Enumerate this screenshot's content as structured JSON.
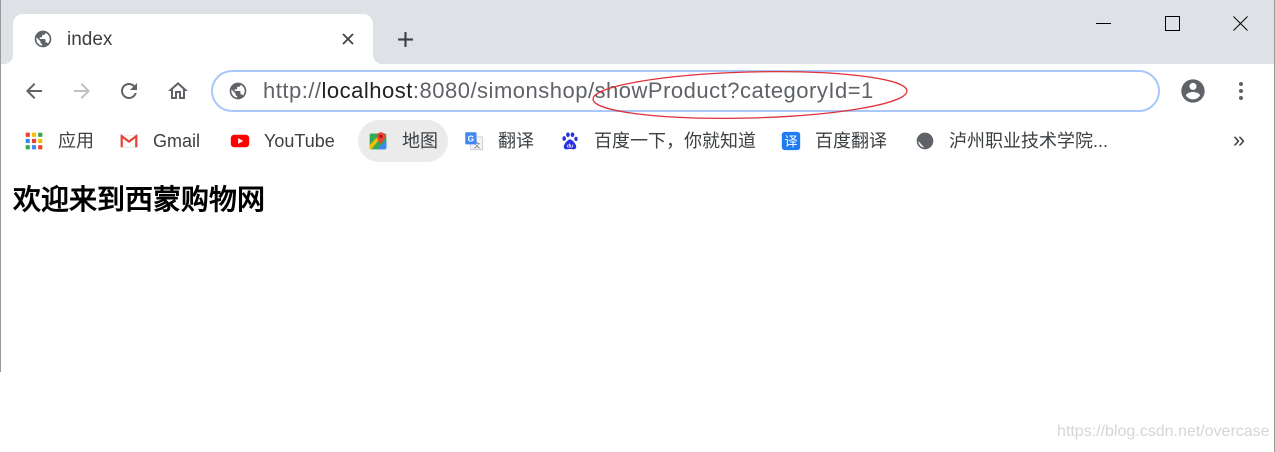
{
  "tabs": [
    {
      "title": "index",
      "favicon": "globe-icon",
      "close_icon": "close-icon",
      "active": true
    }
  ],
  "tab_strip": {
    "new_tab_icon": "plus-icon"
  },
  "window_controls": {
    "minimize_icon": "minimize-icon",
    "maximize_icon": "maximize-icon",
    "close_icon": "close-icon"
  },
  "toolbar": {
    "back_icon": "arrow-back-icon",
    "forward_icon": "arrow-forward-icon",
    "forward_enabled": false,
    "reload_icon": "reload-icon",
    "home_icon": "home-icon",
    "profile_icon": "account-circle-icon",
    "menu_icon": "more-vert-icon"
  },
  "omnibox": {
    "site_info_icon": "globe-icon",
    "focused": true,
    "url": {
      "scheme": "http://",
      "host": "localhost",
      "path": ":8080/simonshop/showProduct?categoryId=1"
    }
  },
  "bookmarks": {
    "items": [
      {
        "label": "应用",
        "icon": "apps-grid-icon"
      },
      {
        "label": "Gmail",
        "icon": "gmail-icon"
      },
      {
        "label": "YouTube",
        "icon": "youtube-icon"
      },
      {
        "label": "地图",
        "icon": "google-maps-icon",
        "hovered": true
      },
      {
        "label": "翻译",
        "icon": "google-translate-icon",
        "logo_text": [
          "G",
          "文"
        ]
      },
      {
        "label": "百度一下，你就知道",
        "icon": "baidu-paw-icon",
        "logo_text": "du"
      },
      {
        "label": "百度翻译",
        "icon": "baidu-translate-icon",
        "logo_text": "译"
      },
      {
        "label": "泸州职业技术学院...",
        "icon": "globe-icon"
      }
    ],
    "overflow_label": "»"
  },
  "page": {
    "heading": "欢迎来到西蒙购物网"
  },
  "watermark": "https://blog.csdn.net/overcase",
  "colors": {
    "tabstrip": "#dee1e6",
    "omnibox_border": "#a8c7fa",
    "annotation": "#e0313a",
    "text_primary": "#202124",
    "text_secondary": "#5f6368",
    "hover_bg": "#ebebeb",
    "youtube_red": "#ff0000",
    "baidu_blue": "#2932e1",
    "baidu_translate_blue": "#1e7bf0",
    "watermark": "#d6d6d6"
  }
}
